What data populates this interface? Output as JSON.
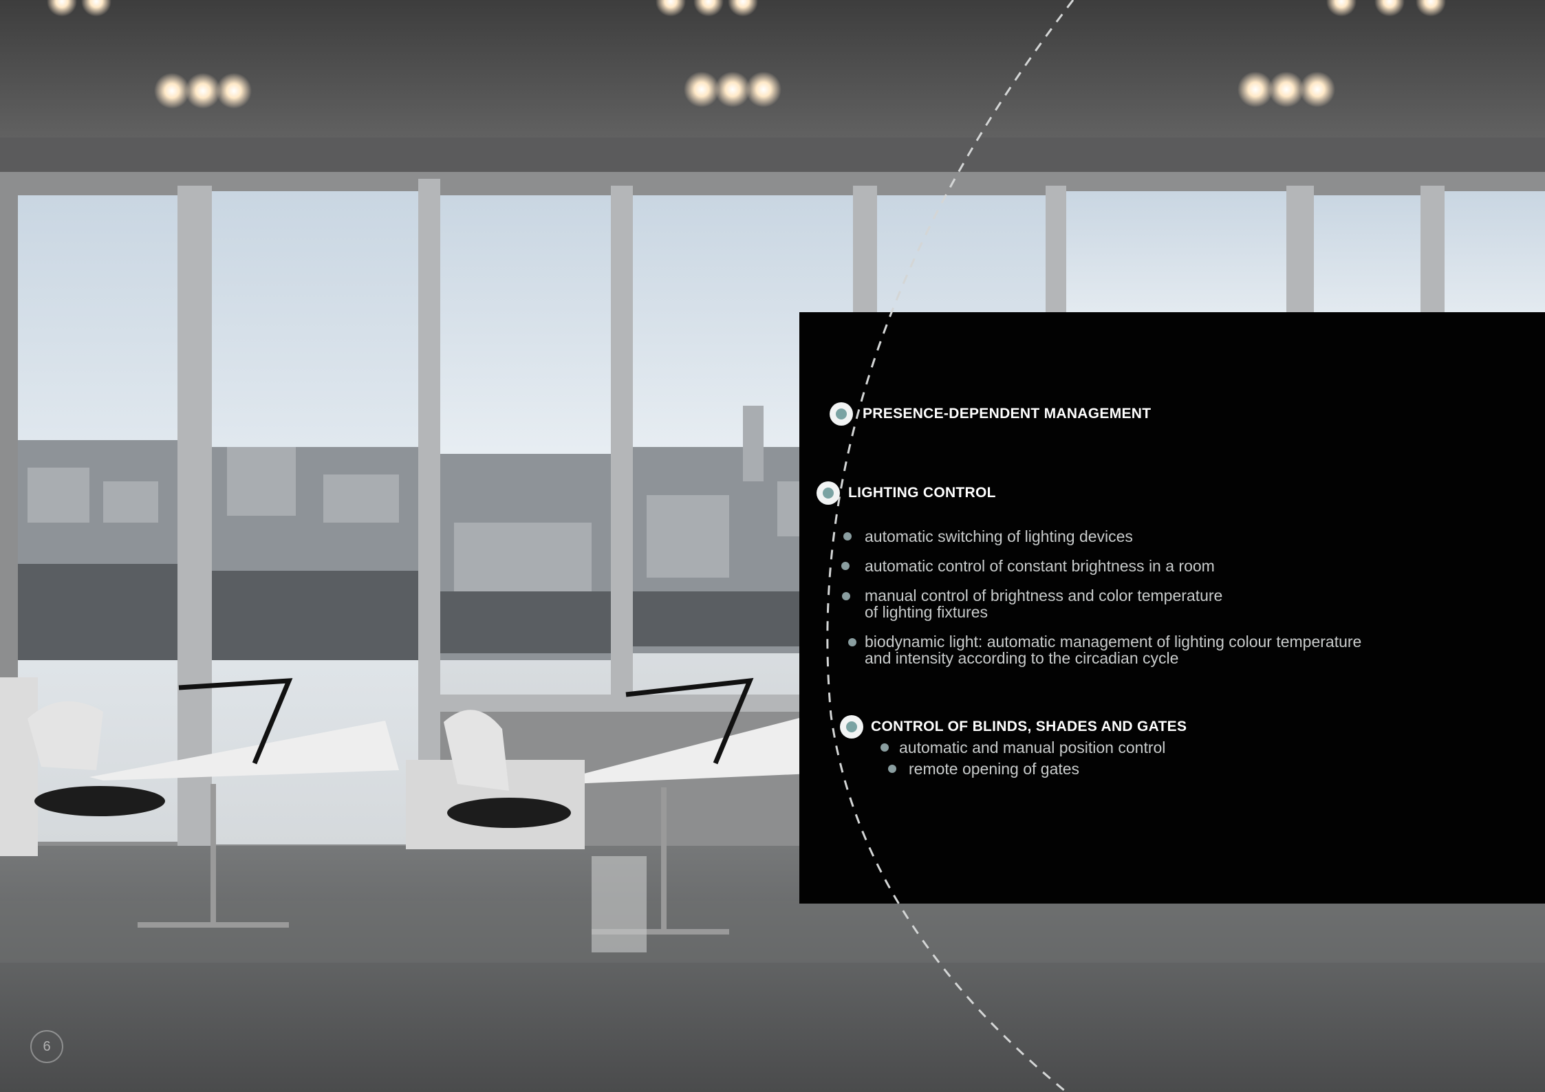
{
  "sections": {
    "presence": {
      "title": "PRESENCE-DEPENDENT MANAGEMENT"
    },
    "lighting": {
      "title": "LIGHTING CONTROL",
      "items": [
        "automatic switching of lighting devices",
        "automatic control of constant brightness in a room",
        "manual control of brightness and color temperature",
        "of lighting fixtures",
        "biodynamic light: automatic management of lighting colour temperature",
        "and intensity according to the circadian cycle"
      ]
    },
    "blinds": {
      "title": "CONTROL OF BLINDS, SHADES AND GATES",
      "items": [
        "automatic and manual position control",
        "remote opening of gates"
      ]
    }
  },
  "page_number": "6",
  "colors": {
    "panel": "#020202",
    "accent": "#7aa3a3",
    "bullet": "#8a9ea0",
    "text": "#c9cccc"
  }
}
